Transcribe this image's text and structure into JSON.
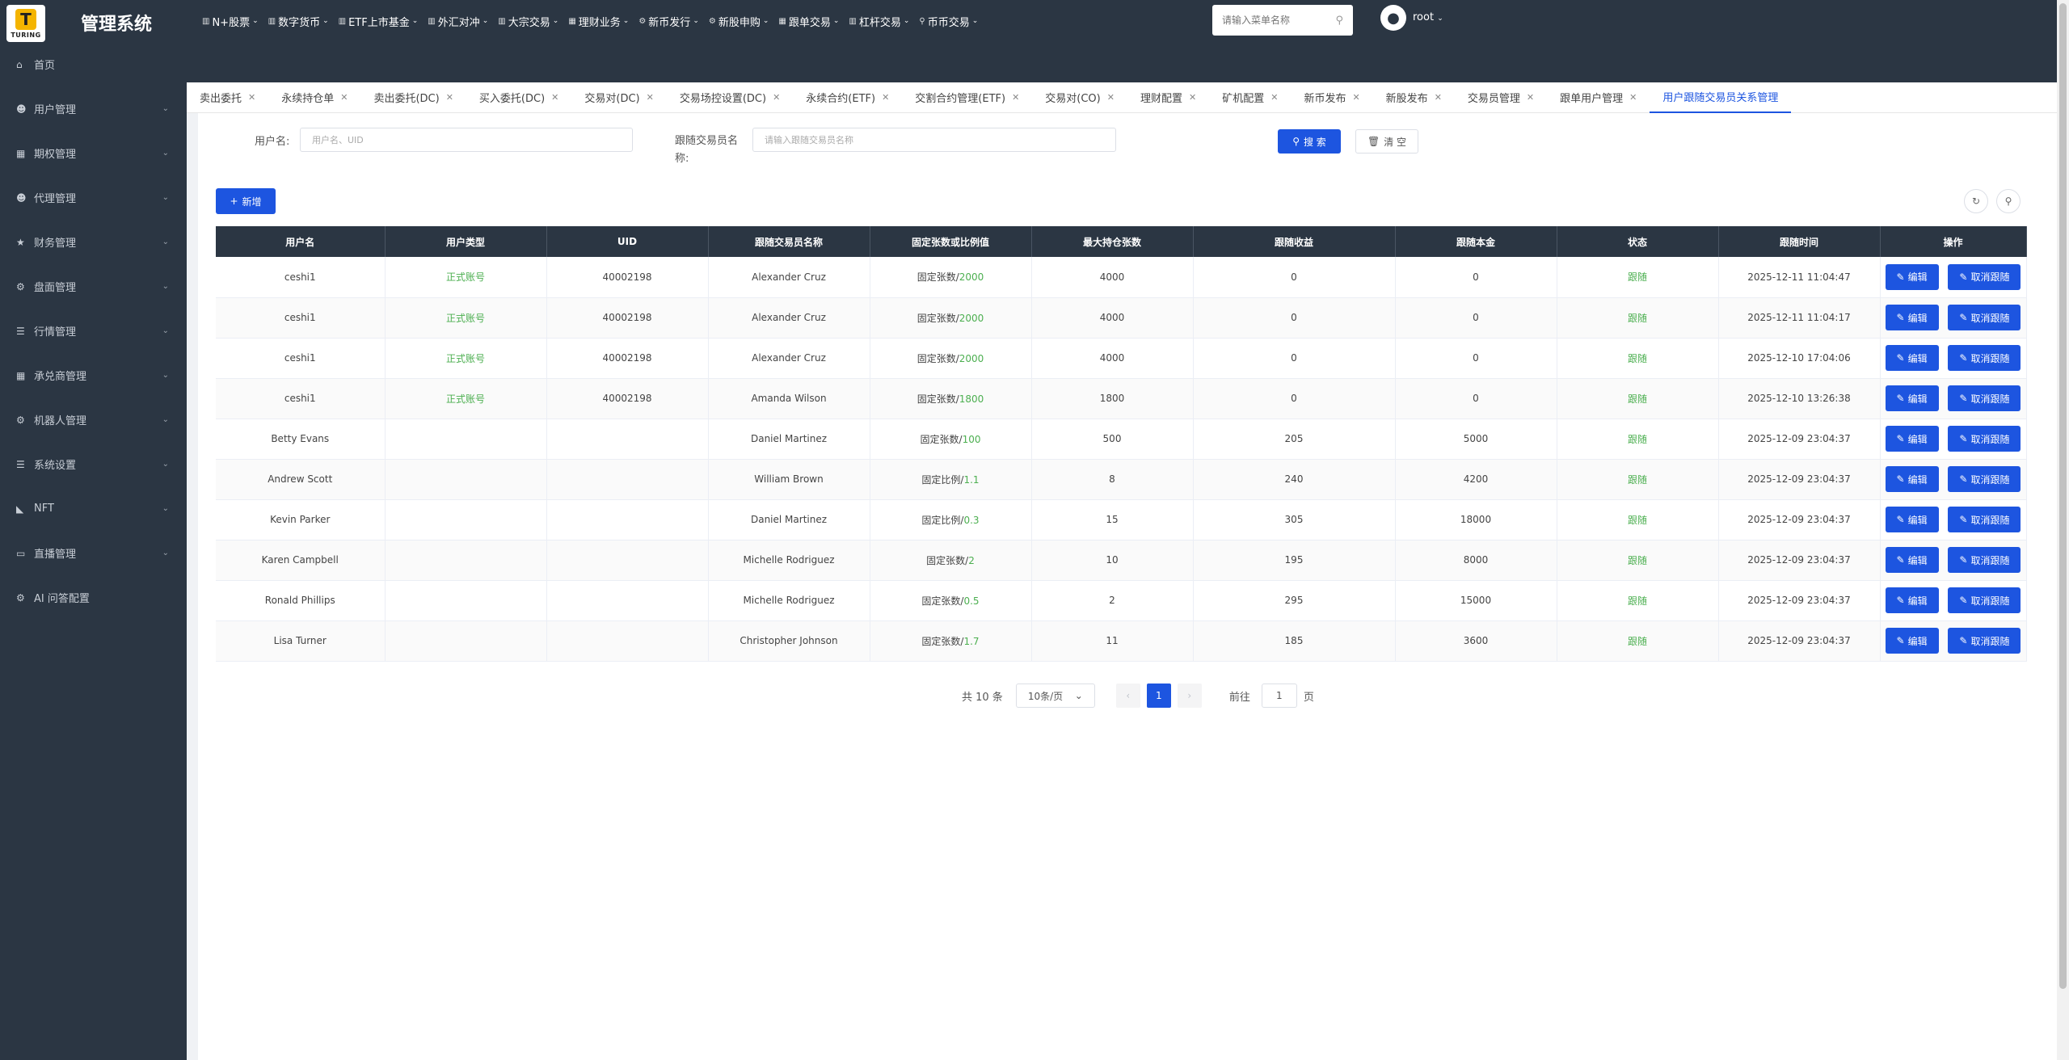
{
  "app": {
    "logo_text": "TURING",
    "title": "管理系统"
  },
  "topnav": [
    {
      "label": "N+股票",
      "icon": "chart-icon"
    },
    {
      "label": "数字货币",
      "icon": "chart-icon"
    },
    {
      "label": "ETF上市基金",
      "icon": "chart-icon"
    },
    {
      "label": "外汇对冲",
      "icon": "chart-icon"
    },
    {
      "label": "大宗交易",
      "icon": "chart-icon"
    },
    {
      "label": "理财业务",
      "icon": "grid-icon"
    },
    {
      "label": "新币发行",
      "icon": "gear-icon"
    },
    {
      "label": "新股申购",
      "icon": "gear-icon"
    },
    {
      "label": "跟单交易",
      "icon": "grid-icon"
    },
    {
      "label": "杠杆交易",
      "icon": "chart-icon"
    },
    {
      "label": "币币交易",
      "icon": "pin-icon"
    }
  ],
  "search": {
    "placeholder": "请输入菜单名称"
  },
  "user": {
    "name": "root"
  },
  "sidebar": [
    {
      "label": "首页",
      "icon": "home-icon",
      "has_children": false
    },
    {
      "label": "用户管理",
      "icon": "user-icon",
      "has_children": true
    },
    {
      "label": "期权管理",
      "icon": "grid-icon",
      "has_children": true
    },
    {
      "label": "代理管理",
      "icon": "user-icon",
      "has_children": true
    },
    {
      "label": "财务管理",
      "icon": "star-icon",
      "has_children": true
    },
    {
      "label": "盘面管理",
      "icon": "gear-icon",
      "has_children": true
    },
    {
      "label": "行情管理",
      "icon": "list-icon",
      "has_children": true
    },
    {
      "label": "承兑商管理",
      "icon": "grid-icon",
      "has_children": true
    },
    {
      "label": "机器人管理",
      "icon": "gear-icon",
      "has_children": true
    },
    {
      "label": "系统设置",
      "icon": "list-icon",
      "has_children": true
    },
    {
      "label": "NFT",
      "icon": "signal-icon",
      "has_children": true
    },
    {
      "label": "直播管理",
      "icon": "video-icon",
      "has_children": true
    },
    {
      "label": "AI 问答配置",
      "icon": "gear-icon",
      "has_children": false
    }
  ],
  "tabs": [
    {
      "label": "卖出委托"
    },
    {
      "label": "永续持仓单"
    },
    {
      "label": "卖出委托(DC)"
    },
    {
      "label": "买入委托(DC)"
    },
    {
      "label": "交易对(DC)"
    },
    {
      "label": "交易场控设置(DC)"
    },
    {
      "label": "永续合约(ETF)"
    },
    {
      "label": "交割合约管理(ETF)"
    },
    {
      "label": "交易对(CO)"
    },
    {
      "label": "理财配置"
    },
    {
      "label": "矿机配置"
    },
    {
      "label": "新币发布"
    },
    {
      "label": "新股发布"
    },
    {
      "label": "交易员管理"
    },
    {
      "label": "跟单用户管理"
    },
    {
      "label": "用户跟随交易员关系管理",
      "active": true
    }
  ],
  "filters": {
    "username_label": "用户名:",
    "username_placeholder": "用户名、UID",
    "trader_label": "跟随交易员名称:",
    "trader_placeholder": "请输入跟随交易员名称",
    "search_btn": "搜 索",
    "reset_btn": "清 空",
    "add_btn": "新增"
  },
  "table": {
    "headers": [
      "用户名",
      "用户类型",
      "UID",
      "跟随交易员名称",
      "固定张数或比例值",
      "最大持仓张数",
      "跟随收益",
      "跟随本金",
      "状态",
      "跟随时间",
      "操作"
    ],
    "edit_label": "编辑",
    "cancel_label": "取消跟随",
    "rows": [
      {
        "username": "ceshi1",
        "type": "正式账号",
        "uid": "40002198",
        "trader": "Alexander Cruz",
        "mode": "固定张数/",
        "mode_value": "2000",
        "max": "4000",
        "profit": "0",
        "principal": "0",
        "status": "跟随",
        "time": "2025-12-11 11:04:47"
      },
      {
        "username": "ceshi1",
        "type": "正式账号",
        "uid": "40002198",
        "trader": "Alexander Cruz",
        "mode": "固定张数/",
        "mode_value": "2000",
        "max": "4000",
        "profit": "0",
        "principal": "0",
        "status": "跟随",
        "time": "2025-12-11 11:04:17"
      },
      {
        "username": "ceshi1",
        "type": "正式账号",
        "uid": "40002198",
        "trader": "Alexander Cruz",
        "mode": "固定张数/",
        "mode_value": "2000",
        "max": "4000",
        "profit": "0",
        "principal": "0",
        "status": "跟随",
        "time": "2025-12-10 17:04:06"
      },
      {
        "username": "ceshi1",
        "type": "正式账号",
        "uid": "40002198",
        "trader": "Amanda Wilson",
        "mode": "固定张数/",
        "mode_value": "1800",
        "max": "1800",
        "profit": "0",
        "principal": "0",
        "status": "跟随",
        "time": "2025-12-10 13:26:38"
      },
      {
        "username": "Betty Evans",
        "type": "",
        "uid": "",
        "trader": "Daniel Martinez",
        "mode": "固定张数/",
        "mode_value": "100",
        "max": "500",
        "profit": "205",
        "principal": "5000",
        "status": "跟随",
        "time": "2025-12-09 23:04:37"
      },
      {
        "username": "Andrew Scott",
        "type": "",
        "uid": "",
        "trader": "William Brown",
        "mode": "固定比例/",
        "mode_value": "1.1",
        "max": "8",
        "profit": "240",
        "principal": "4200",
        "status": "跟随",
        "time": "2025-12-09 23:04:37"
      },
      {
        "username": "Kevin Parker",
        "type": "",
        "uid": "",
        "trader": "Daniel Martinez",
        "mode": "固定比例/",
        "mode_value": "0.3",
        "max": "15",
        "profit": "305",
        "principal": "18000",
        "status": "跟随",
        "time": "2025-12-09 23:04:37"
      },
      {
        "username": "Karen Campbell",
        "type": "",
        "uid": "",
        "trader": "Michelle Rodriguez",
        "mode": "固定张数/",
        "mode_value": "2",
        "max": "10",
        "profit": "195",
        "principal": "8000",
        "status": "跟随",
        "time": "2025-12-09 23:04:37"
      },
      {
        "username": "Ronald Phillips",
        "type": "",
        "uid": "",
        "trader": "Michelle Rodriguez",
        "mode": "固定张数/",
        "mode_value": "0.5",
        "max": "2",
        "profit": "295",
        "principal": "15000",
        "status": "跟随",
        "time": "2025-12-09 23:04:37"
      },
      {
        "username": "Lisa Turner",
        "type": "",
        "uid": "",
        "trader": "Christopher Johnson",
        "mode": "固定张数/",
        "mode_value": "1.7",
        "max": "11",
        "profit": "185",
        "principal": "3600",
        "status": "跟随",
        "time": "2025-12-09 23:04:37"
      }
    ]
  },
  "pagination": {
    "total": "共 10 条",
    "page_size": "10条/页",
    "current_page": "1",
    "goto_label": "前往",
    "goto_value": "1",
    "page_suffix": "页"
  },
  "colors": {
    "primary": "#1d55e0",
    "sidebar_bg": "#2b3643",
    "status_green": "#4caf50"
  }
}
